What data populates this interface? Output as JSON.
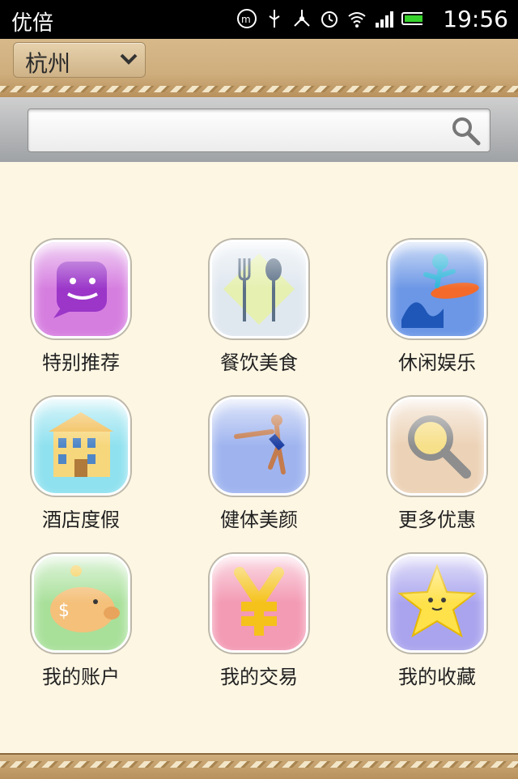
{
  "status_bar": {
    "app_name": "优倍",
    "time": "19:56"
  },
  "header": {
    "city": "杭州"
  },
  "search": {
    "placeholder": ""
  },
  "menu": [
    {
      "label": "特别推荐",
      "icon": "chat-face-icon",
      "color": "#c24fd0"
    },
    {
      "label": "餐饮美食",
      "icon": "fork-spoon-icon",
      "color": "#9bb4c8"
    },
    {
      "label": "休闲娱乐",
      "icon": "surfer-icon",
      "color": "#4a7fd8"
    },
    {
      "label": "酒店度假",
      "icon": "hotel-building-icon",
      "color": "#58c8e0"
    },
    {
      "label": "健体美颜",
      "icon": "gymnast-icon",
      "color": "#6e8fe0"
    },
    {
      "label": "更多优惠",
      "icon": "magnifier-icon",
      "color": "#d9b58c"
    },
    {
      "label": "我的账户",
      "icon": "piggy-bank-icon",
      "color": "#7fd07a"
    },
    {
      "label": "我的交易",
      "icon": "yen-sign-icon",
      "color": "#e86b8f"
    },
    {
      "label": "我的收藏",
      "icon": "star-icon",
      "color": "#8a83e6"
    }
  ]
}
